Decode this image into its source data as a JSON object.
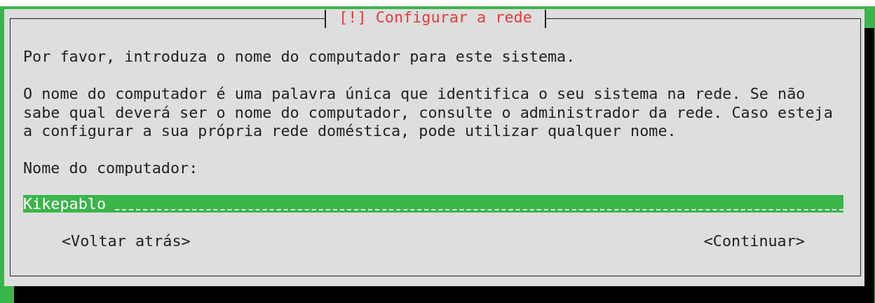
{
  "dialog": {
    "title": "[!] Configurar a rede",
    "paragraphs": [
      "Por favor, introduza o nome do computador para este sistema.",
      "O nome do computador é uma palavra única que identifica o seu sistema na rede. Se não sabe qual deverá ser o nome do computador, consulte o administrador da rede. Caso esteja a configurar a sua própria rede doméstica, pode utilizar qualquer nome."
    ],
    "field": {
      "label": "Nome do computador:",
      "value": "Kikepablo"
    },
    "buttons": [
      "<Voltar atrás>",
      "<Continuar>"
    ]
  }
}
